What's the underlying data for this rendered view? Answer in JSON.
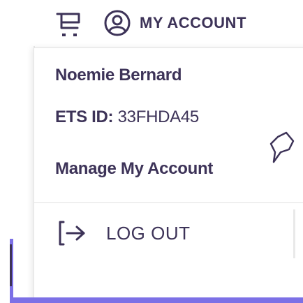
{
  "header": {
    "cart_icon": "shopping-cart-icon",
    "account_icon": "user-circle-icon",
    "account_label": "MY ACCOUNT"
  },
  "dropdown": {
    "user_name": "Noemie Bernard",
    "ets_id_label": "ETS ID:",
    "ets_id_value": "33FHDA45",
    "manage_label": "Manage My Account",
    "logout_icon": "logout-arrow-icon",
    "logout_label": "LOG OUT"
  },
  "chat_icon": "chat-bubble-icon",
  "colors": {
    "text_primary": "#3d3358",
    "accent_purple": "#7c70e6",
    "divider": "#e2e2e2"
  }
}
